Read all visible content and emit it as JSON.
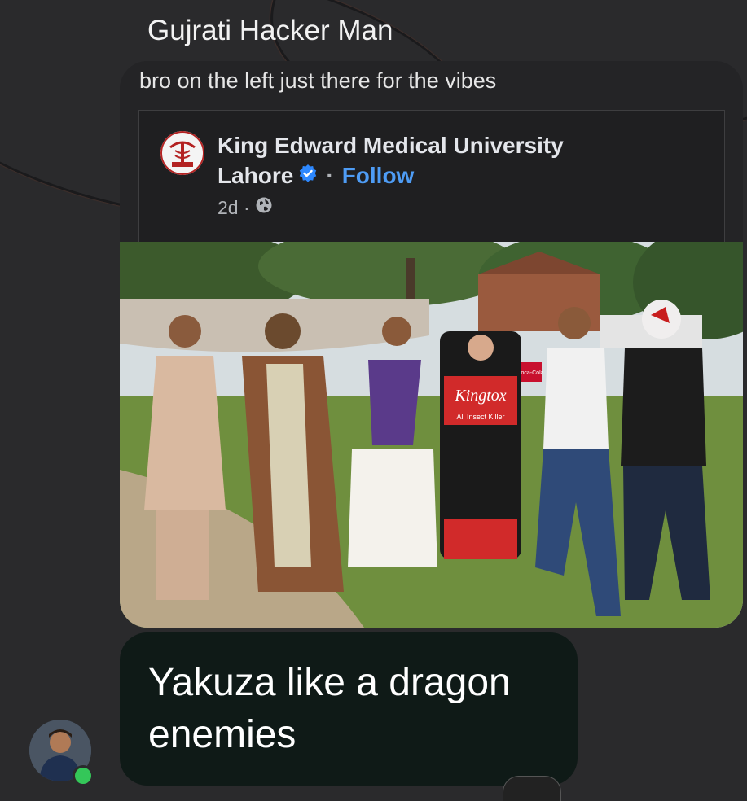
{
  "thread": {
    "sender_name": "Gujrati Hacker Man",
    "shared_message": {
      "caption": "bro on the left just there for the vibes",
      "post": {
        "page_name": "King Edward Medical University Lahore",
        "verified_icon": "verified-badge-icon",
        "follow_label": "Follow",
        "time": "2d",
        "privacy_icon": "globe-icon",
        "photo": {
          "sign_text": "Coca-Cola",
          "costume_label": "Kingtox",
          "costume_sublabel": "All Insect Killer"
        }
      }
    },
    "reply": {
      "text": "Yakuza like a dragon enemies"
    },
    "avatar": {
      "status": "online",
      "status_color": "#34c759"
    }
  }
}
